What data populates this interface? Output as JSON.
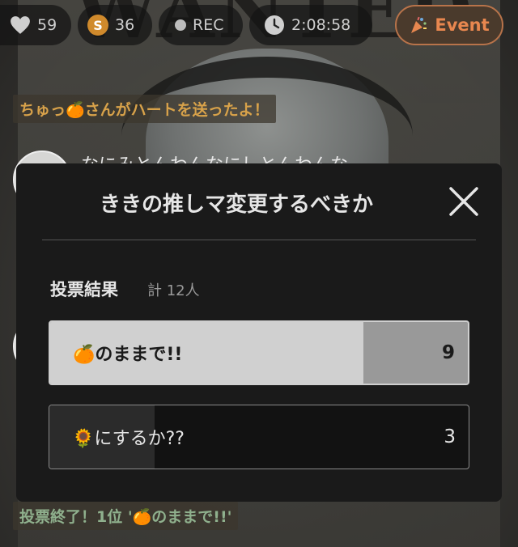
{
  "status": {
    "hearts": "59",
    "coin_symbol": "S",
    "coins": "36",
    "rec_label": "REC",
    "timer": "2:08:58",
    "event_label": "Event"
  },
  "stream": {
    "poster_text": "WANTED",
    "faint_comment": "なにみとんわんなにしとんわんな"
  },
  "notices": {
    "heart_message": "ちゅっ🍊さんがハートを送ったよ！",
    "vote_end_message": "投票終了！1位 '🍊のままで!!'"
  },
  "poll": {
    "title": "ききの推しマ変更するべきか",
    "results_label": "投票結果",
    "total_label": "計 12人",
    "options": [
      {
        "label": "🍊のままで!!",
        "count": "9",
        "fraction": 0.75
      },
      {
        "label": "🌻にするか??",
        "count": "3",
        "fraction": 0.25
      }
    ]
  },
  "colors": {
    "modal_bg": "#1a1a1a",
    "event_accent": "#e8874f",
    "heart_notice": "#d8a24a",
    "vote_notice": "#8fb08d"
  }
}
